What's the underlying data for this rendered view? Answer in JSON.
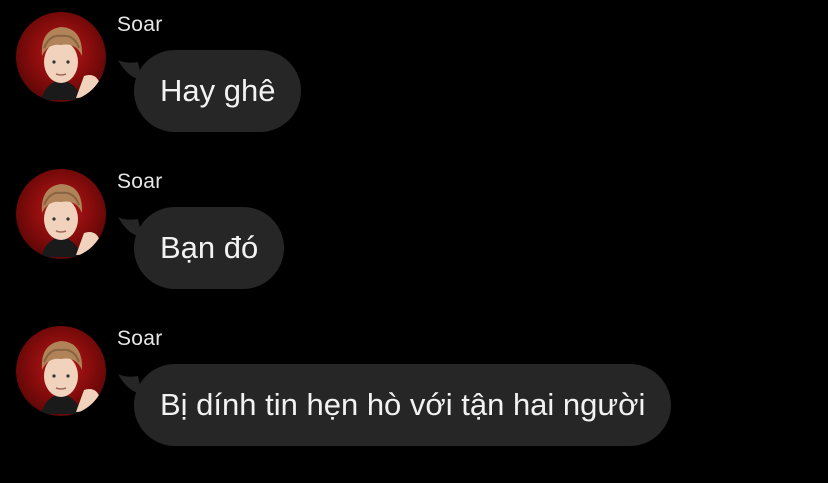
{
  "messages": [
    {
      "sender": "Soar",
      "text": "Hay ghê"
    },
    {
      "sender": "Soar",
      "text": "Bạn đó"
    },
    {
      "sender": "Soar",
      "text": "Bị dính tin hẹn hò với tận hai người"
    }
  ],
  "colors": {
    "background": "#000000",
    "bubble": "#262626",
    "text": "#f2f2f2",
    "avatar_bg": "#b01515"
  },
  "icons": {
    "avatar": "profile-photo"
  }
}
